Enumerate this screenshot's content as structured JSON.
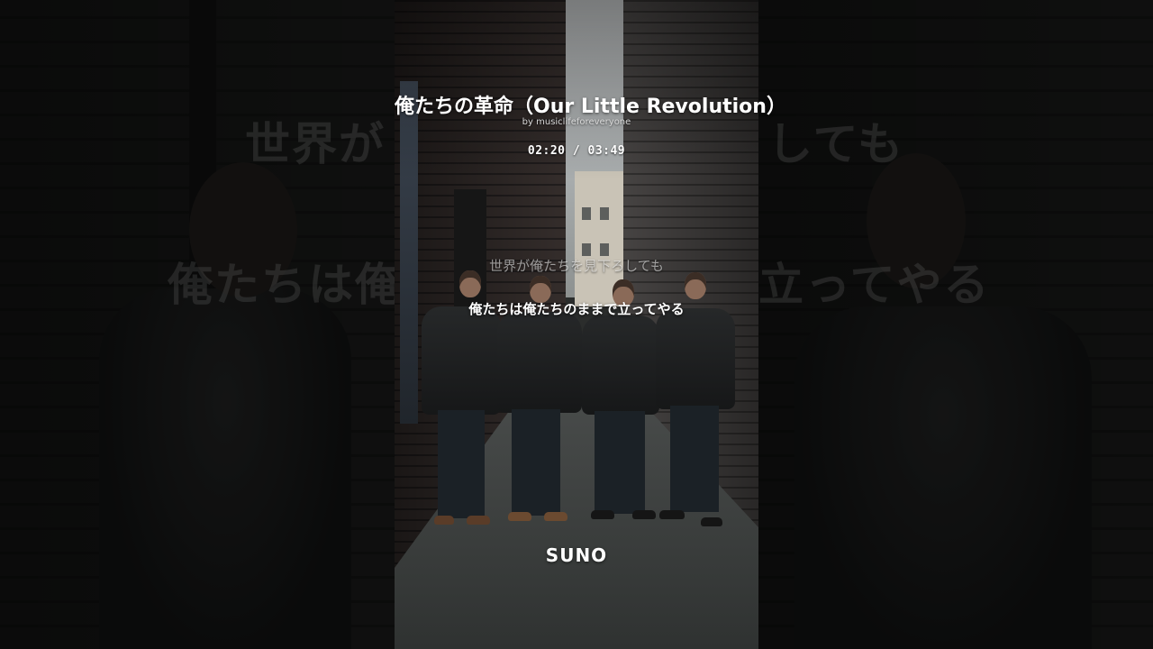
{
  "song": {
    "title": "俺たちの革命（Our Little Revolution）",
    "author": "by musiclifeforeveryone"
  },
  "player": {
    "time": "02:20 / 03:49"
  },
  "lyrics": {
    "previous": "世界が俺たちを見下ろしても",
    "current": "俺たちは俺たちのままで立ってやる",
    "backdrop_left_top": "世界が",
    "backdrop_left_bottom": "俺たちは俺",
    "backdrop_right_top": "しても",
    "backdrop_right_bottom": "立ってやる"
  },
  "branding": {
    "logo_text": "SUNO"
  },
  "colors": {
    "text_primary": "#ffffff",
    "text_dim": "rgba(255,255,255,0.55)"
  }
}
